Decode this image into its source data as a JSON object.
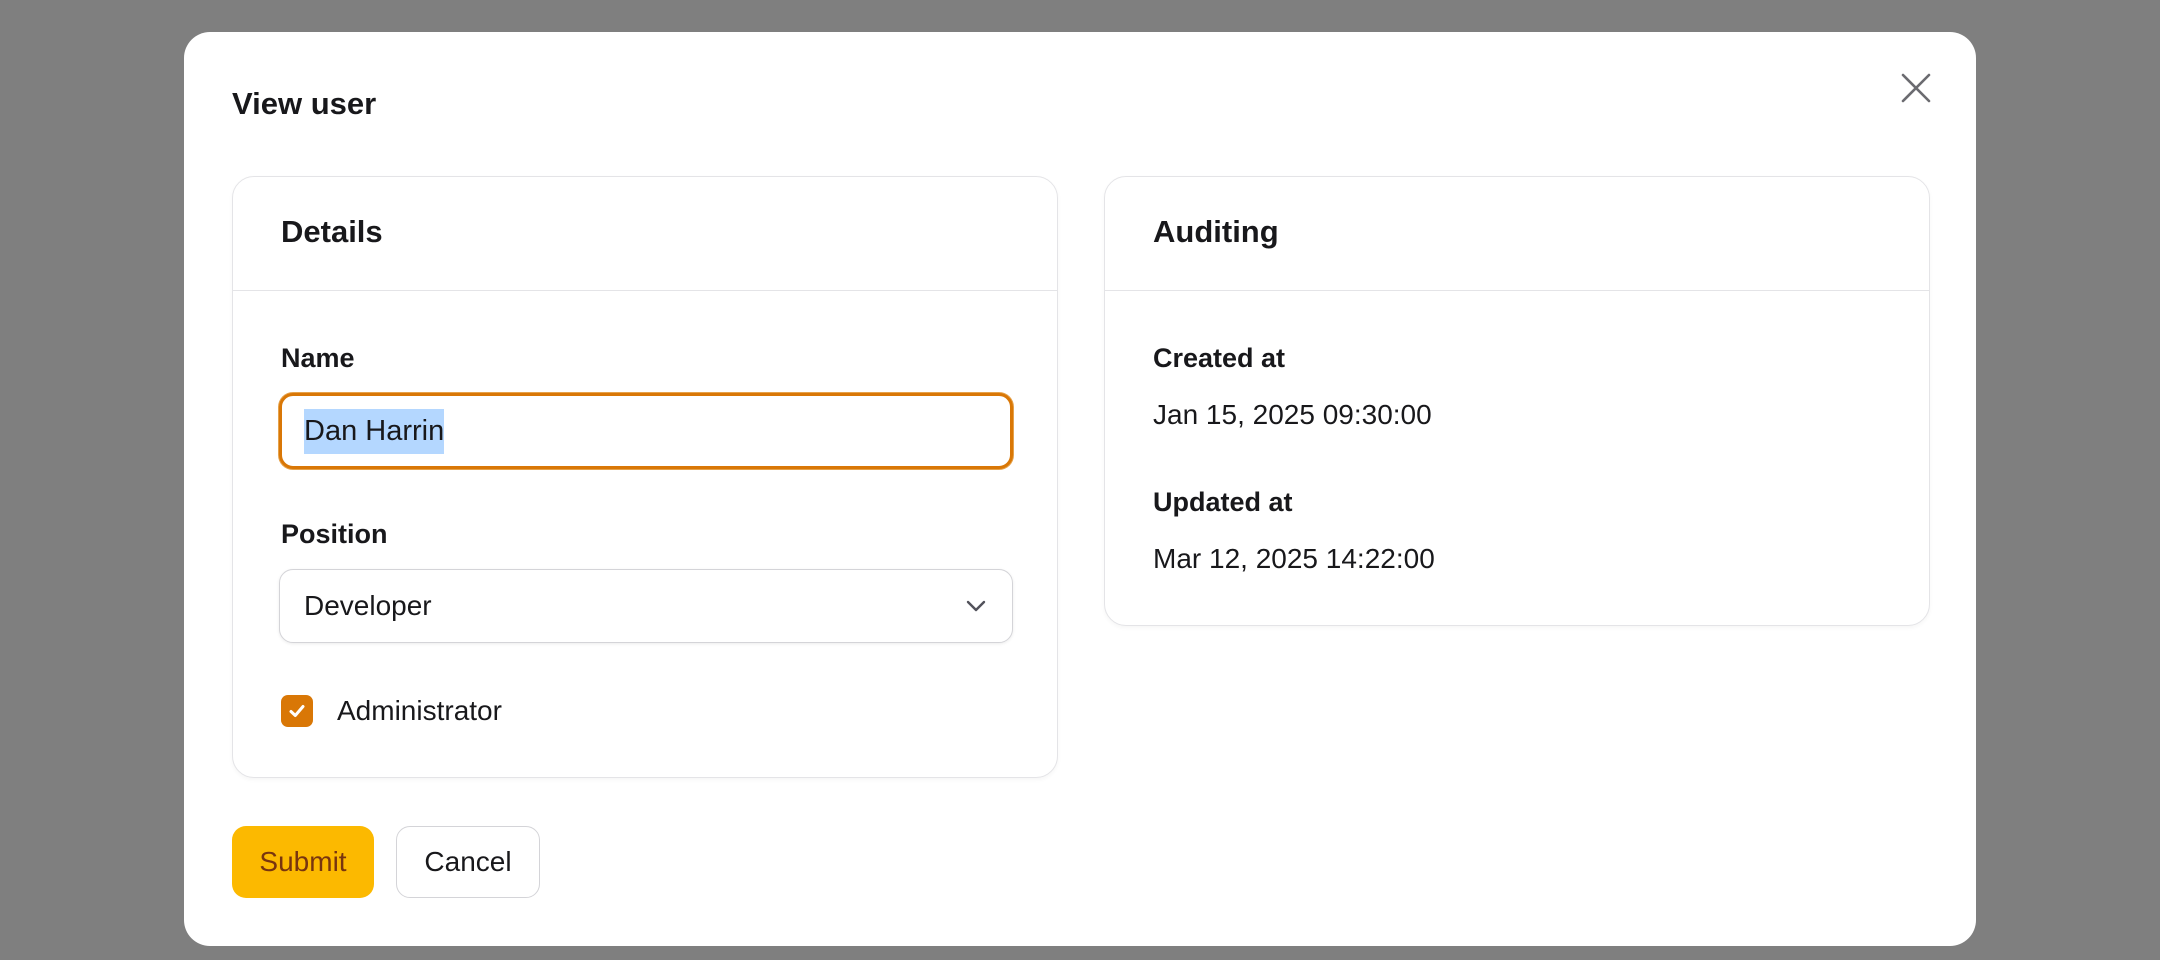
{
  "modal": {
    "title": "View user",
    "close_icon": "close-icon"
  },
  "details": {
    "heading": "Details",
    "name_label": "Name",
    "name_value": "Dan Harrin",
    "position_label": "Position",
    "position_value": "Developer",
    "administrator_label": "Administrator",
    "administrator_checked": true
  },
  "auditing": {
    "heading": "Auditing",
    "created_label": "Created at",
    "created_value": "Jan 15, 2025 09:30:00",
    "updated_label": "Updated at",
    "updated_value": "Mar 12, 2025 14:22:00"
  },
  "actions": {
    "submit_label": "Submit",
    "cancel_label": "Cancel"
  },
  "colors": {
    "accent": "#d97706",
    "submit_bg": "#fcb900",
    "overlay": "#7f7f7f"
  }
}
